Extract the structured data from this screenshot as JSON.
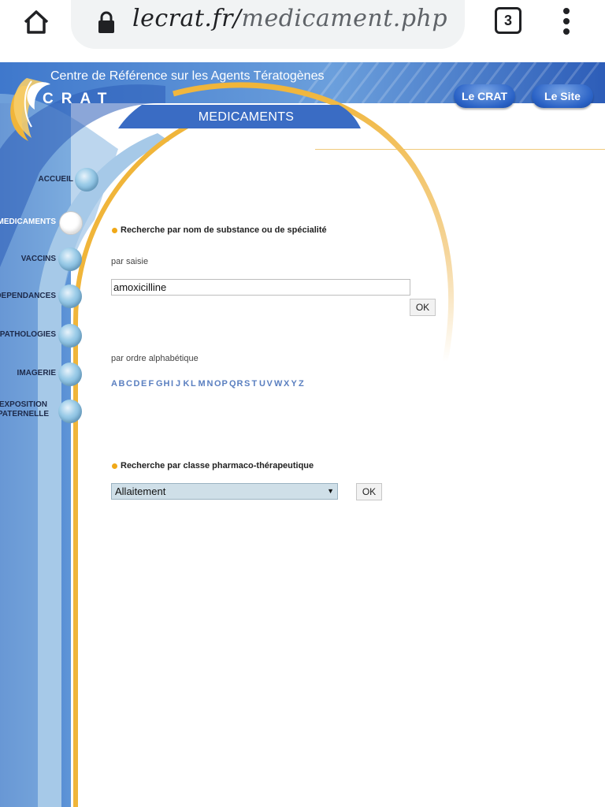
{
  "browser": {
    "url_domain": "lecrat.fr/",
    "url_path": "medicament.php",
    "tab_count": "3",
    "icons": [
      "home-icon",
      "lock-icon",
      "tab-switcher-icon",
      "overflow-menu-icon"
    ]
  },
  "header": {
    "tagline": "Centre de Référence sur les Agents Tératogènes",
    "logo_text": "CRAT",
    "links": [
      {
        "label": "Le CRAT"
      },
      {
        "label": "Le Site"
      }
    ],
    "section_title": "MEDICAMENTS"
  },
  "nav": {
    "items": [
      {
        "label": "ACCUEIL"
      },
      {
        "label": "MEDICAMENTS"
      },
      {
        "label": "VACCINS"
      },
      {
        "label": "DEPENDANCES"
      },
      {
        "label": "PATHOLOGIES"
      },
      {
        "label": "IMAGERIE"
      },
      {
        "label": "EXPOSITION\nPATERNELLE"
      }
    ],
    "active": "MEDICAMENTS"
  },
  "search_name": {
    "heading": "Recherche par nom de substance ou de spécialité",
    "by_input_label": "par saisie",
    "input_value": "amoxicilline",
    "ok_label": "OK",
    "alpha_label": "par ordre alphabétique",
    "letters": [
      "A",
      "B",
      "C",
      "D",
      "E",
      "F",
      "G",
      "H",
      "I",
      "J",
      "K",
      "L",
      "M",
      "N",
      "O",
      "P",
      "Q",
      "R",
      "S",
      "T",
      "U",
      "V",
      "W",
      "X",
      "Y",
      "Z"
    ]
  },
  "search_class": {
    "heading": "Recherche par classe pharmaco-thérapeutique",
    "selected": "Allaitement",
    "ok_label": "OK"
  },
  "colors": {
    "blue_dark": "#2c5cb8",
    "blue_light": "#a6c9e8",
    "gold": "#f0b53a"
  }
}
